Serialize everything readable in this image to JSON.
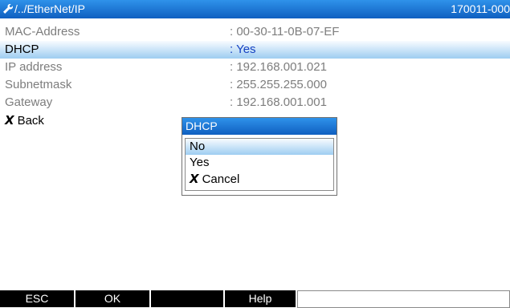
{
  "header": {
    "path": "/../EtherNet/IP",
    "serial": "170011-000",
    "icon": "wrench-icon"
  },
  "rows": [
    {
      "label": "MAC-Address",
      "value": ": 00-30-11-0B-07-EF"
    },
    {
      "label": "DHCP",
      "value": ": Yes"
    },
    {
      "label": "IP address",
      "value": ": 192.168.001.021"
    },
    {
      "label": "Subnetmask",
      "value": ": 255.255.255.000"
    },
    {
      "label": "Gateway",
      "value": ": 192.168.001.001"
    }
  ],
  "back": {
    "glyph": "X",
    "label": "Back"
  },
  "dialog": {
    "title": "DHCP",
    "options": [
      "No",
      "Yes"
    ],
    "cancel": {
      "glyph": "X",
      "label": "Cancel"
    }
  },
  "softkeys": [
    "ESC",
    "OK",
    "",
    "Help"
  ],
  "colors": {
    "title_bar": "#1f7fd9",
    "selection": "#9ecdf1",
    "value_selected": "#1542c2",
    "inactive_text": "#7d7d7d"
  }
}
